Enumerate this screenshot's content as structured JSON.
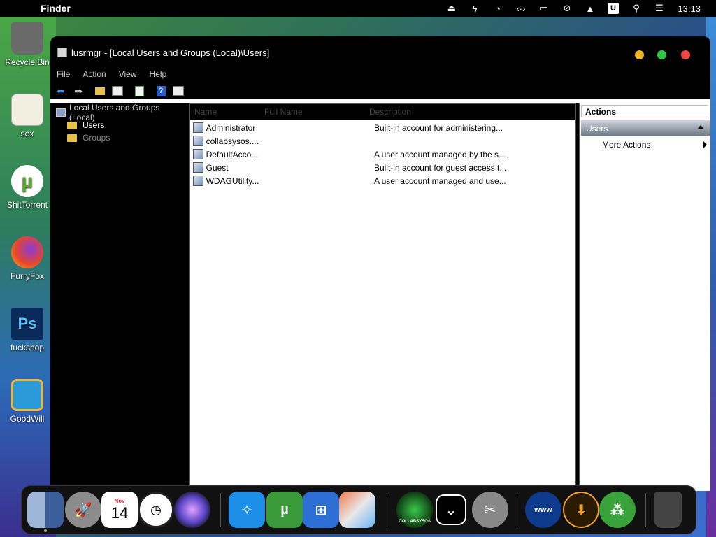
{
  "menubar": {
    "apple_glyph": "",
    "app_name": "Finder",
    "clock": "13:13",
    "icons": [
      "eject-icon",
      "usb-icon",
      "pie-chart-icon",
      "code-arrows-icon",
      "display-icon",
      "mute-icon",
      "upload-icon",
      "u-badge-icon",
      "search-icon",
      "control-center-icon"
    ]
  },
  "desktop": {
    "icons": [
      {
        "label": "Recycle Bin",
        "name": "recycle-bin-icon"
      },
      {
        "label": "sex",
        "name": "notepad-icon"
      },
      {
        "label": "ShitTorrent",
        "name": "utorrent-icon"
      },
      {
        "label": "FurryFox",
        "name": "firefox-icon"
      },
      {
        "label": "fuckshop",
        "name": "photoshop-icon"
      },
      {
        "label": "GoodWill",
        "name": "goodwill-icon"
      }
    ]
  },
  "window": {
    "title": "lusrmgr - [Local Users and Groups (Local)\\Users]",
    "menu": {
      "file": "File",
      "action": "Action",
      "view": "View",
      "help": "Help"
    },
    "tree": {
      "root": "Local Users and Groups (Local)",
      "users": "Users",
      "groups": "Groups"
    },
    "list": {
      "columns": {
        "name": "Name",
        "full_name": "Full Name",
        "description": "Description"
      },
      "rows": [
        {
          "name": "Administrator",
          "full_name": "",
          "description": "Built-in account for administering..."
        },
        {
          "name": "collabsysos....",
          "full_name": "",
          "description": ""
        },
        {
          "name": "DefaultAcco...",
          "full_name": "",
          "description": "A user account managed by the s..."
        },
        {
          "name": "Guest",
          "full_name": "",
          "description": "Built-in account for guest access t..."
        },
        {
          "name": "WDAGUtility...",
          "full_name": "",
          "description": "A user account managed and use..."
        }
      ]
    },
    "actions": {
      "header": "Actions",
      "section": "Users",
      "more": "More Actions"
    }
  },
  "dock": {
    "calendar_month": "Nov",
    "calendar_day": "14",
    "collabsysos_label": "COLLABSYSOS"
  },
  "colors": {
    "traffic_yellow": "#f0b428",
    "traffic_green": "#2fc840",
    "traffic_red": "#f04646"
  }
}
